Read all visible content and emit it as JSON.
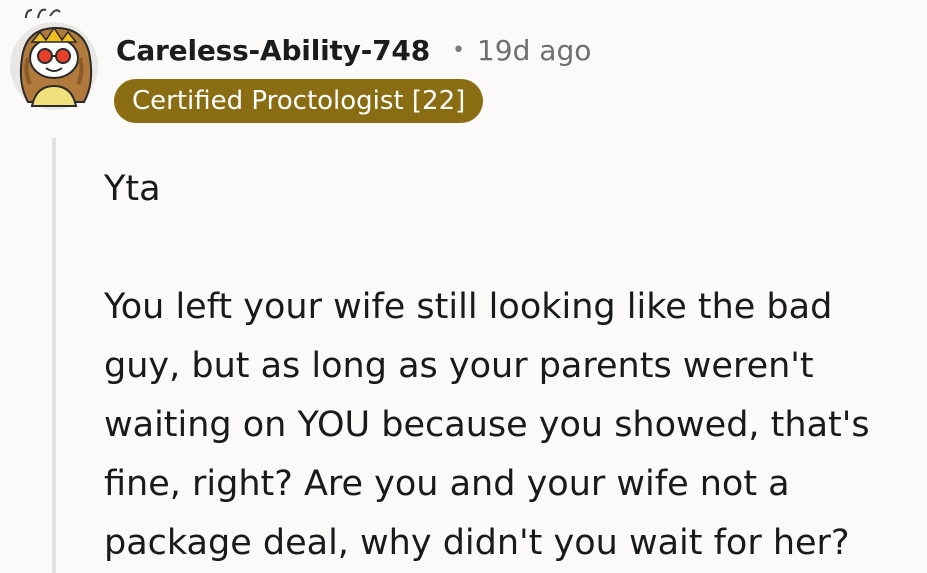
{
  "comment": {
    "author": "Careless-Ability-748",
    "separator": "•",
    "timestamp": "19d ago",
    "flair": "Certified Proctologist [22]",
    "avatar_icon": "snoo-avatar-with-halo-and-sunglasses-icon",
    "paragraphs": [
      "Yta",
      "You left your wife still looking like the bad guy, but as long as your parents weren't waiting on YOU because you showed, that's fine, right? Are you and your wife not a package deal, why didn't you wait for her?"
    ]
  },
  "colors": {
    "background": "#fbfaf9",
    "flair_background": "#8a6d12",
    "flair_text": "#ffffff",
    "thread_line": "#e2e2e2",
    "meta_text": "#6f6f6f"
  }
}
